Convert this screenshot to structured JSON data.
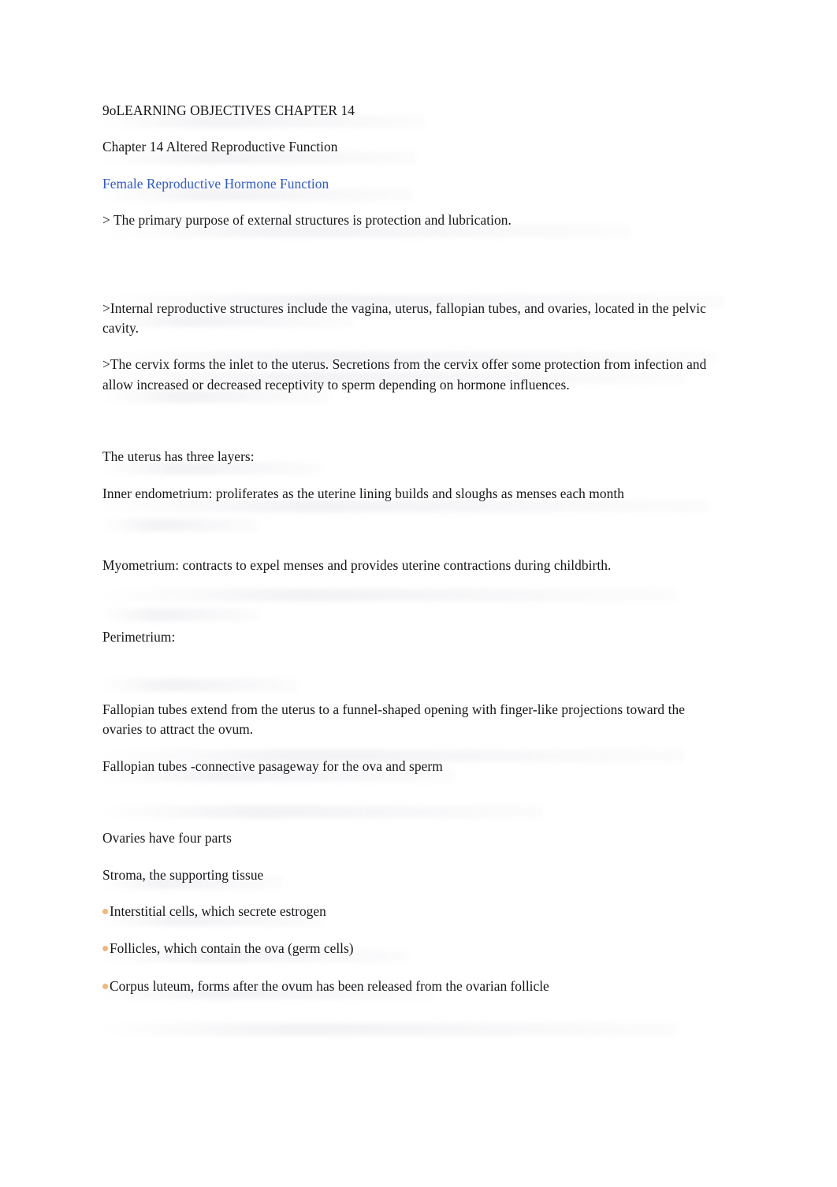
{
  "document": {
    "title_line": "9oLEARNING OBJECTIVES CHAPTER 14",
    "subtitle_line": "Chapter 14 Altered Reproductive Function",
    "section_heading": "Female Reproductive Hormone Function",
    "heading_color": "#2f5bc8",
    "bullet_color": "#f0b878",
    "body_color": "#17171a",
    "background_color": "#ffffff",
    "paragraphs": {
      "external_structures": "> The primary purpose of external structures is protection and lubrication.",
      "internal_structures": ">Internal reproductive structures include the vagina, uterus, fallopian tubes, and ovaries, located in the pelvic cavity.",
      "cervix": ">The cervix forms the inlet to the uterus. Secretions from the cervix offer some protection from infection and allow increased or decreased receptivity to sperm depending on hormone influences.",
      "uterus_layers_intro": "The uterus has three layers:",
      "endometrium": "Inner endometrium: proliferates as the uterine lining builds and sloughs as menses each month",
      "myometrium": "Myometrium: contracts to expel menses and provides uterine contractions during childbirth.",
      "perimetrium": "Perimetrium:",
      "fallopian_tubes_extend": "Fallopian tubes extend from the uterus to a funnel-shaped opening with finger-like projections toward the ovaries to attract the ovum.",
      "fallopian_tubes_passageway": "Fallopian tubes -connective pasageway for the ova and sperm",
      "ovaries_intro": "Ovaries have four parts",
      "stroma": "Stroma, the supporting tissue"
    },
    "ovary_bullets": [
      {
        "text": "Interstitial cells, which secrete estrogen"
      },
      {
        "text": "Follicles, which contain the ova (germ cells)"
      },
      {
        "text": "Corpus luteum, forms after the ovum has been released from the ovarian follicle"
      }
    ]
  }
}
